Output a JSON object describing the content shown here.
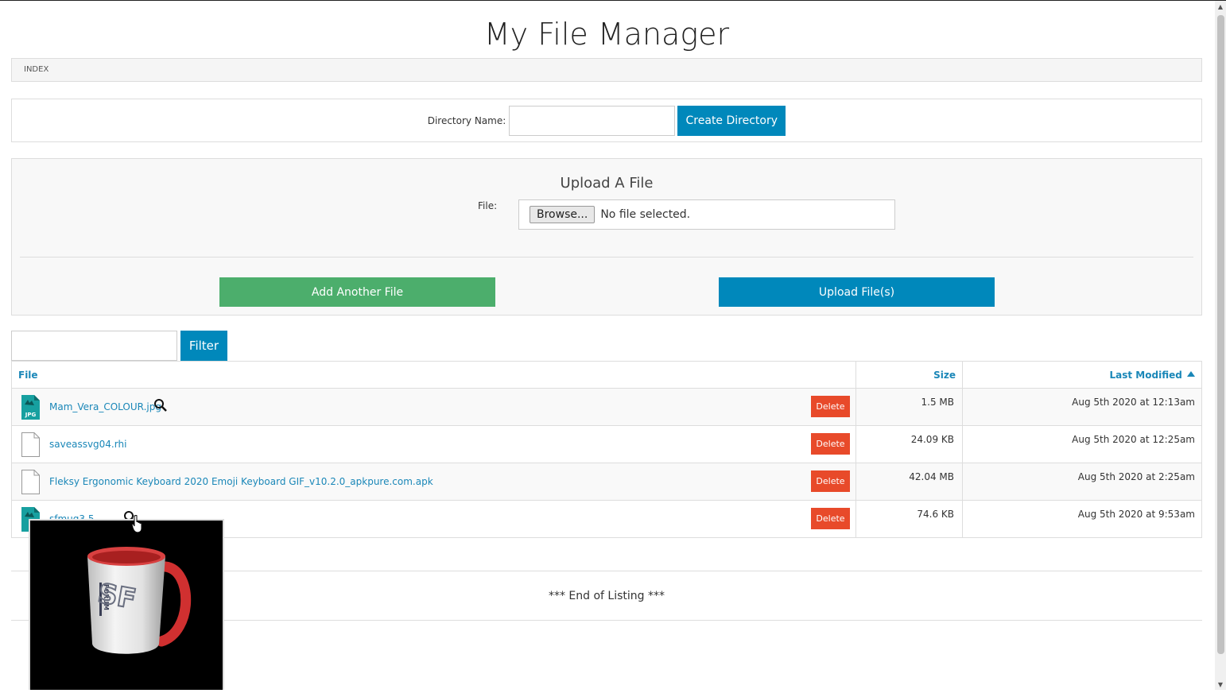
{
  "page_title": "My File Manager",
  "breadcrumb": "INDEX",
  "directory": {
    "label": "Directory Name:",
    "value": "",
    "create_label": "Create Directory"
  },
  "upload": {
    "title": "Upload A File",
    "file_label": "File:",
    "browse_label": "Browse...",
    "no_file_text": "No file selected.",
    "add_another_label": "Add Another File",
    "upload_label": "Upload File(s)"
  },
  "filter": {
    "value": "",
    "button_label": "Filter"
  },
  "table": {
    "headers": {
      "file": "File",
      "size": "Size",
      "last_modified": "Last Modified"
    },
    "sort": {
      "column": "Last Modified",
      "direction": "ascending"
    },
    "delete_label": "Delete",
    "rows": [
      {
        "name": "Mam_Vera_COLOUR.jpg",
        "type": "jpg",
        "icon": "jpg-file-icon",
        "has_preview": true,
        "size": "1.5 MB",
        "modified": "Aug 5th 2020 at 12:13am"
      },
      {
        "name": "saveassvg04.rhi",
        "type": "generic",
        "icon": "generic-file-icon",
        "has_preview": false,
        "size": "24.09 KB",
        "modified": "Aug 5th 2020 at 12:25am"
      },
      {
        "name": "Fleksy Ergonomic Keyboard 2020 Emoji Keyboard GIF_v10.2.0_apkpure.com.apk",
        "type": "generic",
        "icon": "generic-file-icon",
        "has_preview": false,
        "size": "42.04 MB",
        "modified": "Aug 5th 2020 at 2:25am"
      },
      {
        "name": "sfmug3.5",
        "type": "image",
        "icon": "image-file-icon",
        "has_preview": true,
        "size": "74.6 KB",
        "modified": "Aug 5th 2020 at 9:53am"
      }
    ]
  },
  "end_text": "*** End of Listing ***",
  "preview_popup": {
    "visible": true,
    "subject": "white mug with red interior and handle, SF logo and FORUM text"
  },
  "colors": {
    "primary_blue": "#0088bb",
    "success_green": "#4cae6c",
    "danger_red": "#e84a2a",
    "link_blue": "#1a87b8"
  }
}
